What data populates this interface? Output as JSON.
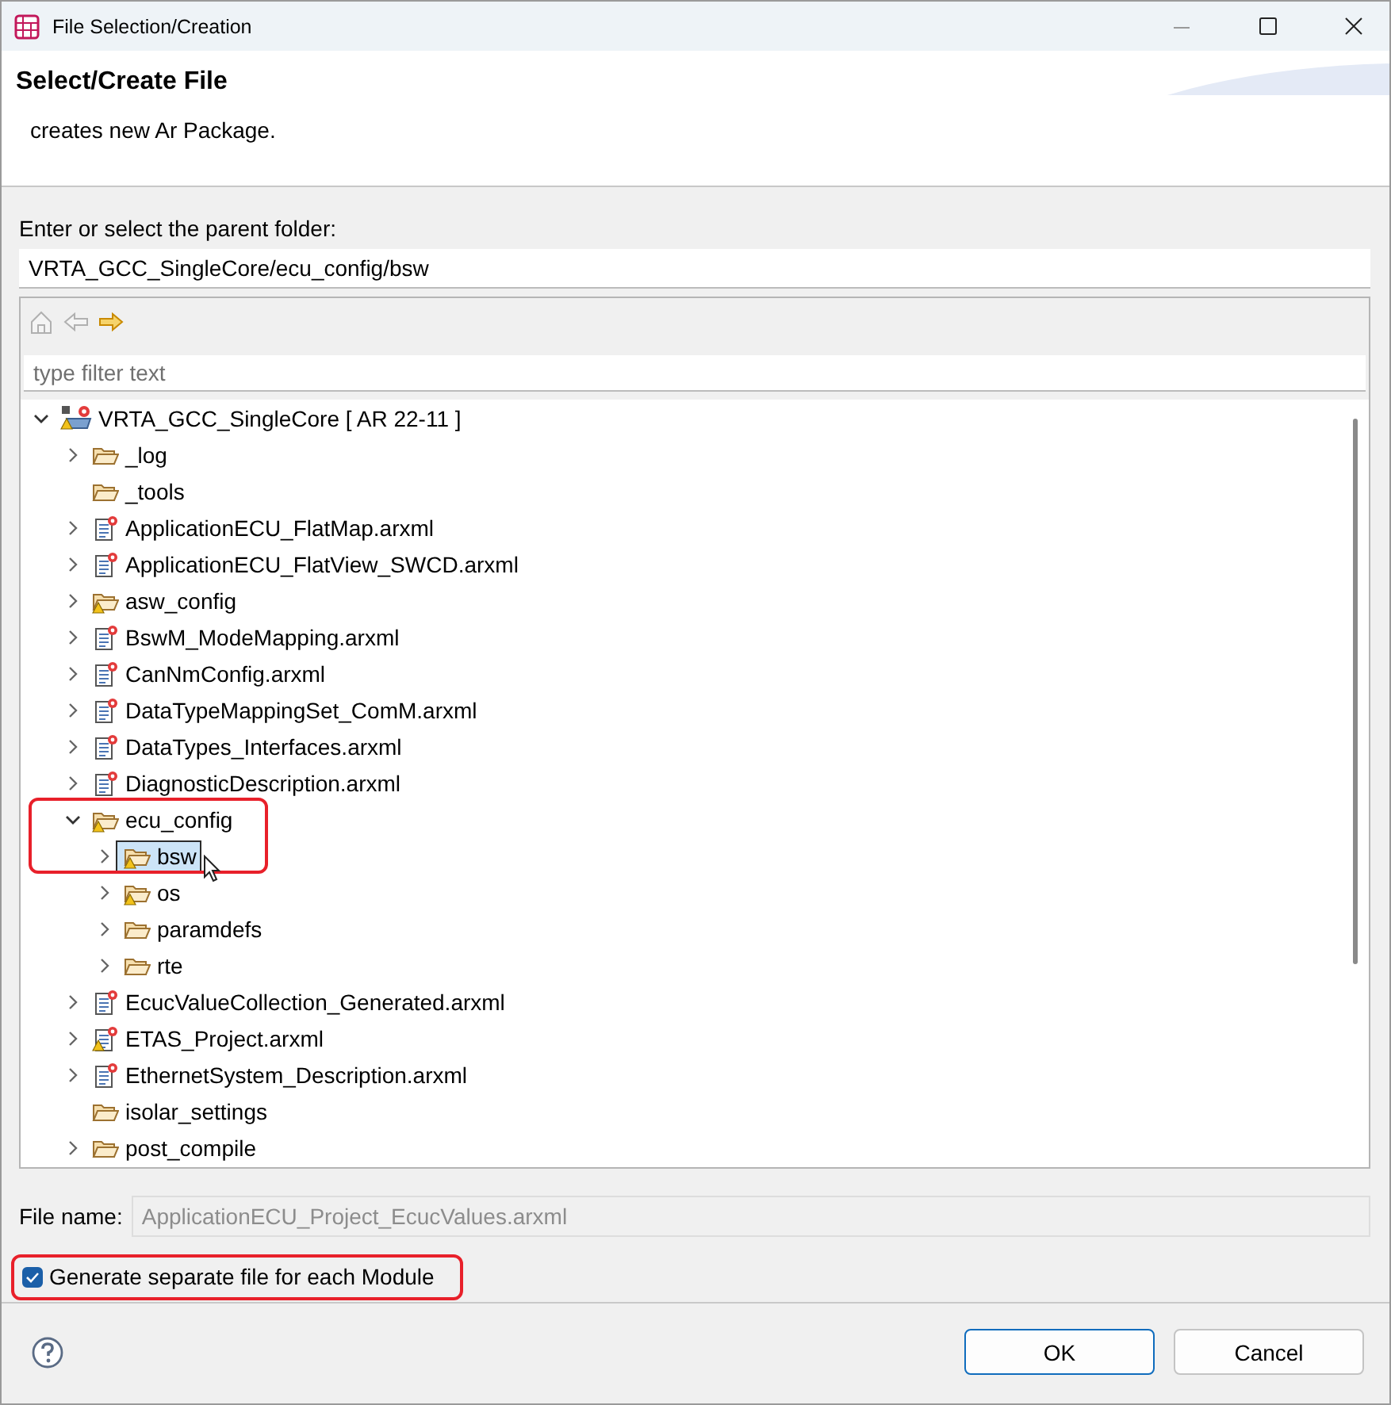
{
  "window": {
    "title": "File Selection/Creation"
  },
  "header": {
    "title": "Select/Create File",
    "description": "creates new Ar Package."
  },
  "parent_folder": {
    "label": "Enter or select the parent folder:",
    "value": "VRTA_GCC_SingleCore/ecu_config/bsw"
  },
  "toolbar": [
    {
      "kind": "home",
      "disabled": true
    },
    {
      "kind": "back",
      "disabled": true
    },
    {
      "kind": "forward",
      "disabled": false
    }
  ],
  "filter": {
    "placeholder": "type filter text"
  },
  "tree": [
    {
      "label": "VRTA_GCC_SingleCore [ AR 22-11 ]",
      "kind": "project",
      "expandable": true,
      "expanded": true,
      "warning": true,
      "selected": false,
      "children": [
        {
          "label": "_log",
          "kind": "folder",
          "expandable": true,
          "expanded": false,
          "warning": false,
          "selected": false
        },
        {
          "label": "_tools",
          "kind": "folder",
          "expandable": false,
          "expanded": false,
          "warning": false,
          "selected": false
        },
        {
          "label": "ApplicationECU_FlatMap.arxml",
          "kind": "file",
          "expandable": true,
          "expanded": false,
          "warning": false,
          "selected": false
        },
        {
          "label": "ApplicationECU_FlatView_SWCD.arxml",
          "kind": "file",
          "expandable": true,
          "expanded": false,
          "warning": false,
          "selected": false
        },
        {
          "label": "asw_config",
          "kind": "folder",
          "expandable": true,
          "expanded": false,
          "warning": true,
          "selected": false
        },
        {
          "label": "BswM_ModeMapping.arxml",
          "kind": "file",
          "expandable": true,
          "expanded": false,
          "warning": false,
          "selected": false
        },
        {
          "label": "CanNmConfig.arxml",
          "kind": "file",
          "expandable": true,
          "expanded": false,
          "warning": false,
          "selected": false
        },
        {
          "label": "DataTypeMappingSet_ComM.arxml",
          "kind": "file",
          "expandable": true,
          "expanded": false,
          "warning": false,
          "selected": false
        },
        {
          "label": "DataTypes_Interfaces.arxml",
          "kind": "file",
          "expandable": true,
          "expanded": false,
          "warning": false,
          "selected": false
        },
        {
          "label": "DiagnosticDescription.arxml",
          "kind": "file",
          "expandable": true,
          "expanded": false,
          "warning": false,
          "selected": false
        },
        {
          "label": "ecu_config",
          "kind": "folder",
          "expandable": true,
          "expanded": true,
          "warning": true,
          "selected": false,
          "annotated": true,
          "children": [
            {
              "label": "bsw",
              "kind": "folder",
              "expandable": true,
              "expanded": false,
              "warning": true,
              "selected": true
            },
            {
              "label": "os",
              "kind": "folder",
              "expandable": true,
              "expanded": false,
              "warning": true,
              "selected": false
            },
            {
              "label": "paramdefs",
              "kind": "folder",
              "expandable": true,
              "expanded": false,
              "warning": false,
              "selected": false
            },
            {
              "label": "rte",
              "kind": "folder",
              "expandable": true,
              "expanded": false,
              "warning": false,
              "selected": false
            }
          ]
        },
        {
          "label": "EcucValueCollection_Generated.arxml",
          "kind": "file",
          "expandable": true,
          "expanded": false,
          "warning": false,
          "selected": false
        },
        {
          "label": "ETAS_Project.arxml",
          "kind": "file",
          "expandable": true,
          "expanded": false,
          "warning": true,
          "selected": false
        },
        {
          "label": "EthernetSystem_Description.arxml",
          "kind": "file",
          "expandable": true,
          "expanded": false,
          "warning": false,
          "selected": false
        },
        {
          "label": "isolar_settings",
          "kind": "folder",
          "expandable": false,
          "expanded": false,
          "warning": false,
          "selected": false
        },
        {
          "label": "post_compile",
          "kind": "folder",
          "expandable": true,
          "expanded": false,
          "warning": false,
          "selected": false
        }
      ]
    }
  ],
  "file_name": {
    "label": "File name:",
    "value": "ApplicationECU_Project_EcucValues.arxml",
    "disabled": true
  },
  "option": {
    "label": "Generate separate file for each Module",
    "checked": true,
    "annotated": true
  },
  "buttons": [
    {
      "label": "OK",
      "default": true
    },
    {
      "label": "Cancel",
      "default": false
    }
  ]
}
